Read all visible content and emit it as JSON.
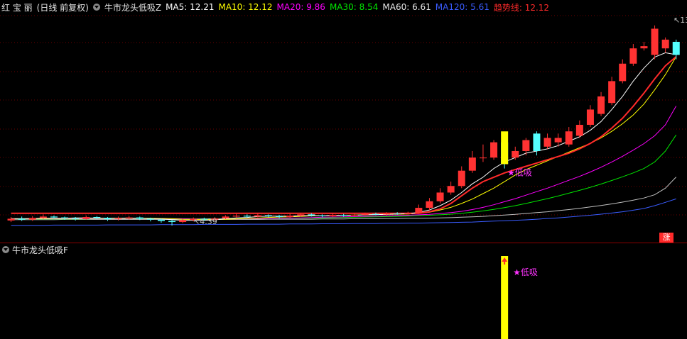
{
  "header": {
    "stock_name": "红 宝 丽",
    "period": "(日线 前复权)",
    "indicator_name": "牛市龙头低吸Z",
    "ma5": "MA5: 12.21",
    "ma10": "MA10: 12.12",
    "ma20": "MA20: 9.86",
    "ma30": "MA30: 8.54",
    "ma60": "MA60: 6.61",
    "ma120": "MA120: 5.61",
    "trend": "趋势线: 12.12"
  },
  "main_chart": {
    "high_label": "13.",
    "low_label": "4.39",
    "signal_label": "低吸",
    "badge": "涨"
  },
  "sub_chart": {
    "indicator_name": "牛市龙头低吸F",
    "signal_label": "低吸"
  },
  "colors": {
    "up": "#ff3232",
    "down": "#54ffff",
    "ma5": "#ffffff",
    "ma10": "#ffff00",
    "ma20": "#ff00ff",
    "ma30": "#00e600",
    "ma60": "#c0c0c0",
    "ma120": "#3a5cff",
    "trend": "#ff2a2a",
    "signal": "#ffff00",
    "grid": "#6b0000"
  },
  "chart_data": {
    "type": "candlestick",
    "ylim": [
      4,
      14
    ],
    "candles": [
      [
        4.62,
        4.7,
        4.78,
        4.55
      ],
      [
        4.7,
        4.66,
        4.8,
        4.6
      ],
      [
        4.66,
        4.74,
        4.82,
        4.6
      ],
      [
        4.74,
        4.8,
        4.9,
        4.7
      ],
      [
        4.8,
        4.76,
        4.85,
        4.7
      ],
      [
        4.76,
        4.72,
        4.8,
        4.65
      ],
      [
        4.72,
        4.7,
        4.78,
        4.62
      ],
      [
        4.7,
        4.78,
        4.85,
        4.65
      ],
      [
        4.78,
        4.74,
        4.82,
        4.68
      ],
      [
        4.74,
        4.68,
        4.78,
        4.6
      ],
      [
        4.68,
        4.72,
        4.8,
        4.62
      ],
      [
        4.72,
        4.76,
        4.82,
        4.66
      ],
      [
        4.76,
        4.7,
        4.8,
        4.64
      ],
      [
        4.7,
        4.66,
        4.75,
        4.58
      ],
      [
        4.66,
        4.6,
        4.7,
        4.52
      ],
      [
        4.6,
        4.55,
        4.65,
        4.39
      ],
      [
        4.55,
        4.64,
        4.7,
        4.5
      ],
      [
        4.64,
        4.7,
        4.76,
        4.58
      ],
      [
        4.7,
        4.66,
        4.75,
        4.6
      ],
      [
        4.66,
        4.72,
        4.78,
        4.62
      ],
      [
        4.72,
        4.8,
        4.86,
        4.68
      ],
      [
        4.8,
        4.84,
        4.92,
        4.74
      ],
      [
        4.84,
        4.8,
        4.9,
        4.74
      ],
      [
        4.8,
        4.86,
        4.94,
        4.76
      ],
      [
        4.86,
        4.82,
        4.9,
        4.76
      ],
      [
        4.82,
        4.78,
        4.88,
        4.72
      ],
      [
        4.78,
        4.84,
        4.92,
        4.74
      ],
      [
        4.84,
        4.9,
        4.96,
        4.8
      ],
      [
        4.9,
        4.86,
        4.95,
        4.8
      ],
      [
        4.86,
        4.82,
        4.9,
        4.76
      ],
      [
        4.82,
        4.88,
        4.94,
        4.78
      ],
      [
        4.88,
        4.84,
        4.92,
        4.8
      ],
      [
        4.84,
        4.88,
        4.95,
        4.8
      ],
      [
        4.88,
        4.92,
        4.98,
        4.84
      ],
      [
        4.92,
        4.9,
        4.98,
        4.86
      ],
      [
        4.9,
        4.94,
        5.0,
        4.86
      ],
      [
        4.94,
        4.92,
        5.0,
        4.88
      ],
      [
        4.92,
        4.96,
        5.02,
        4.88
      ],
      [
        4.96,
        5.2,
        5.35,
        4.92
      ],
      [
        5.2,
        5.5,
        5.65,
        5.1
      ],
      [
        5.5,
        5.9,
        6.1,
        5.4
      ],
      [
        5.9,
        6.2,
        6.4,
        5.8
      ],
      [
        6.2,
        6.9,
        7.1,
        6.1
      ],
      [
        6.9,
        7.5,
        7.8,
        6.8
      ],
      [
        7.5,
        7.5,
        8.1,
        7.3
      ],
      [
        7.5,
        8.2,
        8.3,
        7.4
      ],
      [
        8.2,
        7.2,
        8.3,
        7.0
      ],
      [
        7.5,
        7.8,
        8.0,
        7.4
      ],
      [
        7.8,
        8.3,
        8.4,
        7.6
      ],
      [
        8.6,
        7.8,
        8.7,
        7.6
      ],
      [
        8.0,
        8.4,
        8.6,
        7.9
      ],
      [
        8.2,
        8.4,
        8.6,
        8.0
      ],
      [
        8.1,
        8.7,
        8.9,
        8.0
      ],
      [
        8.5,
        9.0,
        9.2,
        8.4
      ],
      [
        9.0,
        9.7,
        9.9,
        8.9
      ],
      [
        9.5,
        10.3,
        10.5,
        9.4
      ],
      [
        10.0,
        11.0,
        11.2,
        9.9
      ],
      [
        11.0,
        11.8,
        12.0,
        10.9
      ],
      [
        11.8,
        12.5,
        12.7,
        11.7
      ],
      [
        12.5,
        12.6,
        12.8,
        12.4
      ],
      [
        12.2,
        13.4,
        13.55,
        12.0
      ],
      [
        12.5,
        12.9,
        13.0,
        12.3
      ],
      [
        12.8,
        12.2,
        12.9,
        12.0
      ]
    ],
    "ma5": [
      4.7,
      4.7,
      4.71,
      4.72,
      4.72,
      4.72,
      4.74,
      4.74,
      4.73,
      4.72,
      4.72,
      4.73,
      4.72,
      4.7,
      4.69,
      4.66,
      4.63,
      4.63,
      4.63,
      4.65,
      4.7,
      4.74,
      4.76,
      4.8,
      4.82,
      4.82,
      4.82,
      4.84,
      4.84,
      4.84,
      4.86,
      4.86,
      4.86,
      4.88,
      4.89,
      4.9,
      4.92,
      4.93,
      4.99,
      5.1,
      5.3,
      5.55,
      5.9,
      6.3,
      6.6,
      7.0,
      7.3,
      7.5,
      7.7,
      7.8,
      7.9,
      8.05,
      8.25,
      8.45,
      8.75,
      9.15,
      9.7,
      10.3,
      11.0,
      11.6,
      12.1,
      12.3,
      12.21
    ],
    "ma10": [
      4.7,
      4.7,
      4.7,
      4.7,
      4.71,
      4.71,
      4.72,
      4.72,
      4.72,
      4.72,
      4.72,
      4.72,
      4.72,
      4.72,
      4.71,
      4.7,
      4.68,
      4.67,
      4.67,
      4.67,
      4.68,
      4.69,
      4.71,
      4.73,
      4.76,
      4.78,
      4.79,
      4.81,
      4.83,
      4.84,
      4.85,
      4.86,
      4.87,
      4.88,
      4.89,
      4.9,
      4.91,
      4.92,
      4.95,
      5.0,
      5.1,
      5.22,
      5.4,
      5.6,
      5.85,
      6.1,
      6.4,
      6.7,
      6.95,
      7.15,
      7.35,
      7.55,
      7.75,
      7.95,
      8.15,
      8.4,
      8.7,
      9.05,
      9.45,
      9.95,
      10.6,
      11.3,
      12.12
    ],
    "ma20": [
      4.69,
      4.69,
      4.69,
      4.7,
      4.7,
      4.7,
      4.7,
      4.7,
      4.71,
      4.71,
      4.71,
      4.71,
      4.71,
      4.71,
      4.71,
      4.7,
      4.7,
      4.69,
      4.69,
      4.69,
      4.69,
      4.69,
      4.7,
      4.7,
      4.71,
      4.72,
      4.73,
      4.74,
      4.75,
      4.77,
      4.78,
      4.79,
      4.8,
      4.81,
      4.82,
      4.84,
      4.85,
      4.86,
      4.88,
      4.9,
      4.94,
      4.98,
      5.04,
      5.12,
      5.22,
      5.34,
      5.48,
      5.62,
      5.78,
      5.94,
      6.1,
      6.28,
      6.46,
      6.64,
      6.84,
      7.06,
      7.3,
      7.56,
      7.84,
      8.14,
      8.5,
      9.0,
      9.86
    ],
    "ma30": [
      4.68,
      4.68,
      4.68,
      4.69,
      4.69,
      4.69,
      4.69,
      4.69,
      4.7,
      4.7,
      4.7,
      4.7,
      4.7,
      4.7,
      4.7,
      4.7,
      4.7,
      4.7,
      4.7,
      4.7,
      4.7,
      4.7,
      4.7,
      4.7,
      4.71,
      4.71,
      4.72,
      4.72,
      4.73,
      4.74,
      4.75,
      4.76,
      4.77,
      4.78,
      4.79,
      4.8,
      4.81,
      4.82,
      4.84,
      4.86,
      4.88,
      4.91,
      4.95,
      5.0,
      5.06,
      5.13,
      5.21,
      5.3,
      5.4,
      5.51,
      5.62,
      5.74,
      5.87,
      6.0,
      6.14,
      6.29,
      6.45,
      6.62,
      6.8,
      7.0,
      7.3,
      7.8,
      8.54
    ],
    "ma60": [
      4.66,
      4.66,
      4.66,
      4.66,
      4.66,
      4.67,
      4.67,
      4.67,
      4.67,
      4.67,
      4.67,
      4.67,
      4.67,
      4.67,
      4.67,
      4.67,
      4.67,
      4.67,
      4.67,
      4.67,
      4.67,
      4.67,
      4.67,
      4.67,
      4.68,
      4.68,
      4.68,
      4.68,
      4.68,
      4.69,
      4.69,
      4.69,
      4.7,
      4.7,
      4.7,
      4.71,
      4.71,
      4.72,
      4.72,
      4.73,
      4.74,
      4.75,
      4.77,
      4.79,
      4.81,
      4.84,
      4.87,
      4.9,
      4.94,
      4.98,
      5.02,
      5.07,
      5.12,
      5.18,
      5.24,
      5.31,
      5.38,
      5.46,
      5.55,
      5.65,
      5.8,
      6.1,
      6.61
    ],
    "ma120": [
      4.4,
      4.4,
      4.4,
      4.4,
      4.41,
      4.41,
      4.41,
      4.41,
      4.41,
      4.42,
      4.42,
      4.42,
      4.42,
      4.42,
      4.43,
      4.43,
      4.43,
      4.43,
      4.44,
      4.44,
      4.44,
      4.44,
      4.45,
      4.45,
      4.45,
      4.45,
      4.46,
      4.46,
      4.46,
      4.47,
      4.47,
      4.47,
      4.48,
      4.48,
      4.48,
      4.49,
      4.49,
      4.5,
      4.5,
      4.51,
      4.52,
      4.53,
      4.54,
      4.55,
      4.57,
      4.59,
      4.61,
      4.63,
      4.65,
      4.68,
      4.71,
      4.74,
      4.78,
      4.82,
      4.86,
      4.91,
      4.96,
      5.02,
      5.09,
      5.17,
      5.3,
      5.45,
      5.61
    ],
    "trend": [
      4.95,
      4.95,
      4.95,
      4.95,
      4.95,
      4.95,
      4.95,
      4.95,
      4.95,
      4.95,
      4.95,
      4.95,
      4.95,
      4.95,
      4.95,
      4.95,
      4.95,
      4.95,
      4.95,
      4.95,
      4.95,
      4.95,
      4.95,
      4.95,
      4.95,
      4.95,
      4.95,
      4.95,
      4.95,
      4.95,
      4.95,
      4.95,
      4.95,
      4.95,
      4.95,
      4.95,
      4.95,
      4.95,
      4.95,
      5.02,
      5.15,
      5.4,
      5.75,
      6.1,
      6.4,
      6.6,
      6.8,
      6.95,
      7.1,
      7.25,
      7.4,
      7.55,
      7.7,
      7.9,
      8.15,
      8.45,
      8.85,
      9.3,
      9.85,
      10.45,
      11.1,
      11.7,
      12.12
    ],
    "signal_index": 46,
    "signal_price": 7.2,
    "high_price": 13.55,
    "low_price": 4.39
  }
}
